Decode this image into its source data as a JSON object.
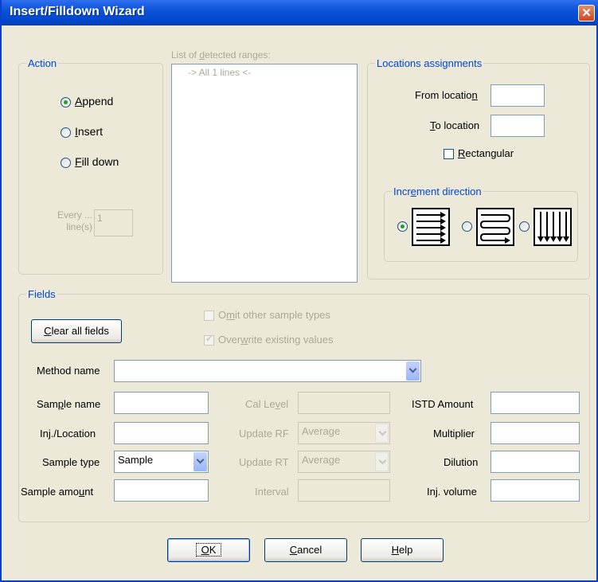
{
  "window": {
    "title": "Insert/Filldown Wizard",
    "close_glyph": "✕"
  },
  "action": {
    "legend": "Action",
    "options": [
      {
        "key": "A",
        "rest": "ppend",
        "selected": true
      },
      {
        "key": "I",
        "rest": "nsert",
        "selected": false
      },
      {
        "key": "F",
        "rest": "ill down",
        "selected": false
      }
    ],
    "every_label_1": "Every ...",
    "every_label_2": "line(s)",
    "every_value": "1"
  },
  "ranges": {
    "label_pre": "List of ",
    "label_key": "d",
    "label_post": "etected ranges:",
    "items": [
      "-> All  1 lines <-"
    ]
  },
  "locations": {
    "legend": "Locations assignments",
    "from_pre": "From locatio",
    "from_key": "n",
    "from_value": "",
    "to_key": "T",
    "to_post": "o location",
    "to_value": "",
    "rect_key": "R",
    "rect_post": "ectangular",
    "rect_checked": false,
    "increment": {
      "legend_pre": "Incr",
      "legend_key": "e",
      "legend_post": "ment direction",
      "selected_index": 0,
      "icons": [
        "rows-increment-icon",
        "serpentine-increment-icon",
        "columns-increment-icon"
      ]
    }
  },
  "fields": {
    "legend": "Fields",
    "clear_key": "C",
    "clear_post": "lear all fields",
    "omit_pre": "O",
    "omit_key": "m",
    "omit_post": "it other sample types",
    "omit_checked": false,
    "overwrite_pre": "Over",
    "overwrite_key": "w",
    "overwrite_post": "rite existing values",
    "overwrite_checked": true,
    "method_name_label": "Method name",
    "method_name_value": "",
    "sample_name_pre": "Sam",
    "sample_name_key": "p",
    "sample_name_post": "le name",
    "sample_name_value": "",
    "inj_location_label": "Inj./Location",
    "inj_location_value": "",
    "sample_type_label": "Sample type",
    "sample_type_value": "Sample",
    "sample_amount_pre": "Sample amo",
    "sample_amount_key": "u",
    "sample_amount_post": "nt",
    "sample_amount_value": "",
    "cal_level_pre": "Cal Le",
    "cal_level_key": "v",
    "cal_level_post": "el",
    "cal_level_value": "",
    "update_rf_label": "Update RF",
    "update_rf_value": "Average",
    "update_rt_label": "Update RT",
    "update_rt_value": "Average",
    "interval_label": "Interval",
    "interval_value": "",
    "istd_amount_label": "ISTD Amount",
    "istd_amount_value": "",
    "multiplier_label": "Multiplier",
    "multiplier_value": "",
    "dilution_label": "Dilution",
    "dilution_value": "",
    "inj_volume_label": "Inj. volume",
    "inj_volume_value": ""
  },
  "buttons": {
    "ok_key": "O",
    "ok_post": "K",
    "cancel_key": "C",
    "cancel_post": "ancel",
    "help_key": "H",
    "help_post": "elp"
  },
  "colors": {
    "title_bar": "#0a53d8",
    "dialog_bg": "#ece9d8",
    "legend_text": "#0046d5",
    "disabled_text": "#aca899",
    "radio_dot": "#21a121"
  }
}
